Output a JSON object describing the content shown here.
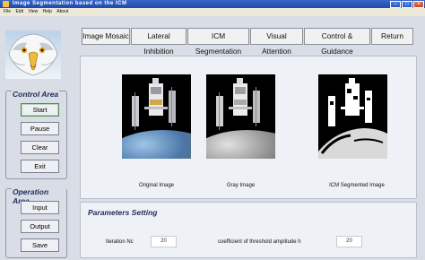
{
  "window": {
    "title": "Image Segmentation based on the ICM"
  },
  "menu": {
    "items": [
      "File",
      "Edit",
      "View",
      "Help",
      "About"
    ]
  },
  "tabs": {
    "items": [
      "Image Mosaic",
      "Lateral Inhibition",
      "ICM Segmentation",
      "Visual Attention",
      "Control & Guidance",
      "Return"
    ]
  },
  "control_area": {
    "title": "Control Area",
    "buttons": [
      "Start",
      "Pause",
      "Clear",
      "Exit"
    ]
  },
  "operation_area": {
    "title": "Operation Area",
    "buttons": [
      "Input",
      "Output",
      "Save"
    ]
  },
  "images": {
    "captions": [
      "Original Image",
      "Gray Image",
      "ICM Segmented Image"
    ]
  },
  "parameters": {
    "title": "Parameters Setting",
    "iteration_label": "Iteration Nc",
    "iteration_value": "20",
    "coef_label": "coefficient of threshold amplitude h",
    "coef_value": "20"
  },
  "colors": {
    "title_bar": "#2a58be",
    "background": "#d8dde6",
    "panel_title": "#1f2c5a"
  }
}
